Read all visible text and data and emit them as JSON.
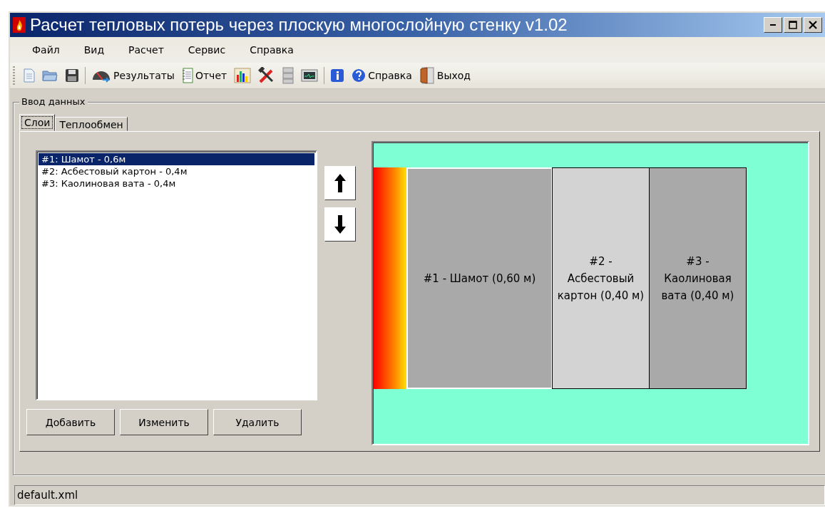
{
  "window": {
    "title": "Расчет тепловых потерь через плоскую многослойную стенку v1.02"
  },
  "menu": [
    "Файл",
    "Вид",
    "Расчет",
    "Сервис",
    "Справка"
  ],
  "toolbar": [
    {
      "kind": "button"
    },
    {
      "kind": "button"
    },
    {
      "kind": "button"
    },
    {
      "kind": "separator"
    },
    {
      "kind": "button",
      "label": "Результаты"
    },
    {
      "kind": "button",
      "label": "Отчет"
    },
    {
      "kind": "button"
    },
    {
      "kind": "button"
    },
    {
      "kind": "button"
    },
    {
      "kind": "button"
    },
    {
      "kind": "separator"
    },
    {
      "kind": "button"
    },
    {
      "kind": "button",
      "label": "Справка"
    },
    {
      "kind": "button",
      "label": "Выход"
    }
  ],
  "group": {
    "title": "Ввод данных"
  },
  "tabs": [
    {
      "label": "Слои",
      "selected": true
    },
    {
      "label": "Теплообмен",
      "selected": false
    }
  ],
  "layer_list": [
    {
      "label": "#1: Шамот - 0,6м",
      "selected": true
    },
    {
      "label": "#2: Асбестовый картон - 0,4м",
      "selected": false
    },
    {
      "label": "#3: Каолиновая вата - 0,4м",
      "selected": false
    }
  ],
  "buttons": [
    "Добавить",
    "Изменить",
    "Удалить"
  ],
  "diagram": {
    "layers": [
      {
        "label": "#1 - Шамот (0,60 м)",
        "color": "#a9a9a9",
        "selected": true
      },
      {
        "label": "#2 - Асбестовый картон (0,40 м)",
        "color": "#d3d3d3",
        "selected": false
      },
      {
        "label": "#3 - Каолиновая вата (0,40 м)",
        "color": "#a9a9a9",
        "selected": false
      }
    ]
  },
  "status_bar": {
    "text": "default.xml"
  }
}
